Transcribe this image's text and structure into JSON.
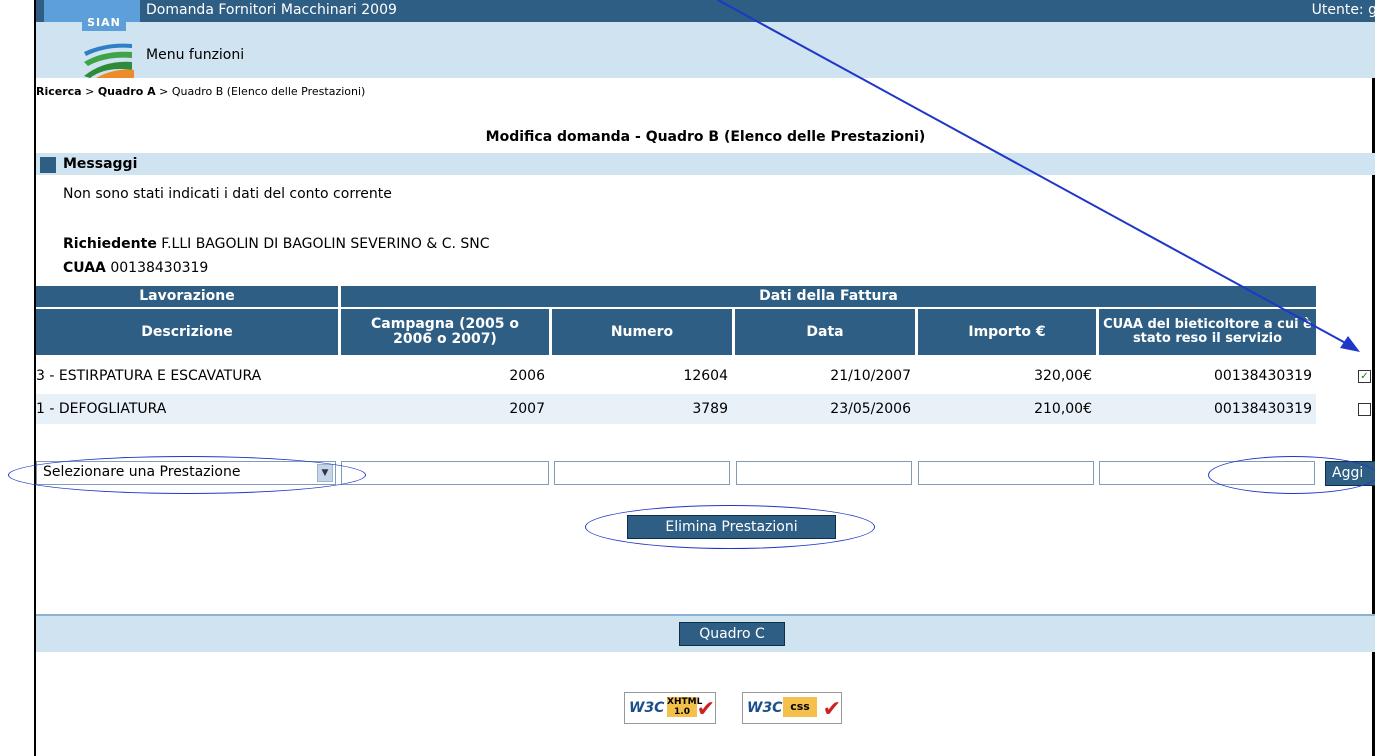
{
  "header": {
    "app_title": "Domanda Fornitori Macchinari 2009",
    "user_label": "Utente: g",
    "logo_text": "SIAN",
    "menu_label": "Menu funzioni"
  },
  "breadcrumb": {
    "item1": "Ricerca",
    "sep": ">",
    "item2": "Quadro A",
    "item3": "Quadro B (Elenco delle Prestazioni)"
  },
  "page_title": "Modifica domanda - Quadro B (Elenco delle Prestazioni)",
  "messages": {
    "heading": "Messaggi",
    "text": "Non sono stati indicati i dati del conto corrente"
  },
  "applicant": {
    "richiedente_label": "Richiedente",
    "richiedente_value": "F.LLI BAGOLIN DI BAGOLIN SEVERINO & C. SNC",
    "cuaa_label": "CUAA",
    "cuaa_value": "00138430319"
  },
  "table": {
    "group_headers": [
      "Lavorazione",
      "Dati della Fattura"
    ],
    "columns": [
      "Descrizione",
      "Campagna (2005 o 2006 o 2007)",
      "Numero",
      "Data",
      "Importo €",
      "CUAA del bieticoltore a cui è stato reso il servizio"
    ],
    "rows": [
      {
        "descrizione": "3 - ESTIRPATURA E ESCAVATURA",
        "campagna": "2006",
        "numero": "12604",
        "data": "21/10/2007",
        "importo": "320,00€",
        "cuaa": "00138430319",
        "checked": true
      },
      {
        "descrizione": "1 - DEFOGLIATURA",
        "campagna": "2007",
        "numero": "3789",
        "data": "23/05/2006",
        "importo": "210,00€",
        "cuaa": "00138430319",
        "checked": false
      }
    ],
    "new_row": {
      "select_value": "Selezionare una Prestazione",
      "add_button": "Aggi"
    }
  },
  "buttons": {
    "delete": "Elimina Prestazioni",
    "next": "Quadro C"
  },
  "badges": {
    "xhtml_logo": "W3C",
    "xhtml_tag_line1": "XHTML",
    "xhtml_tag_line2": "1.0",
    "css_logo": "W3C",
    "css_tag": "css"
  },
  "colors": {
    "header_dark": "#2e5e84",
    "header_light": "#cfe3f1",
    "annotation": "#1f37c8"
  }
}
